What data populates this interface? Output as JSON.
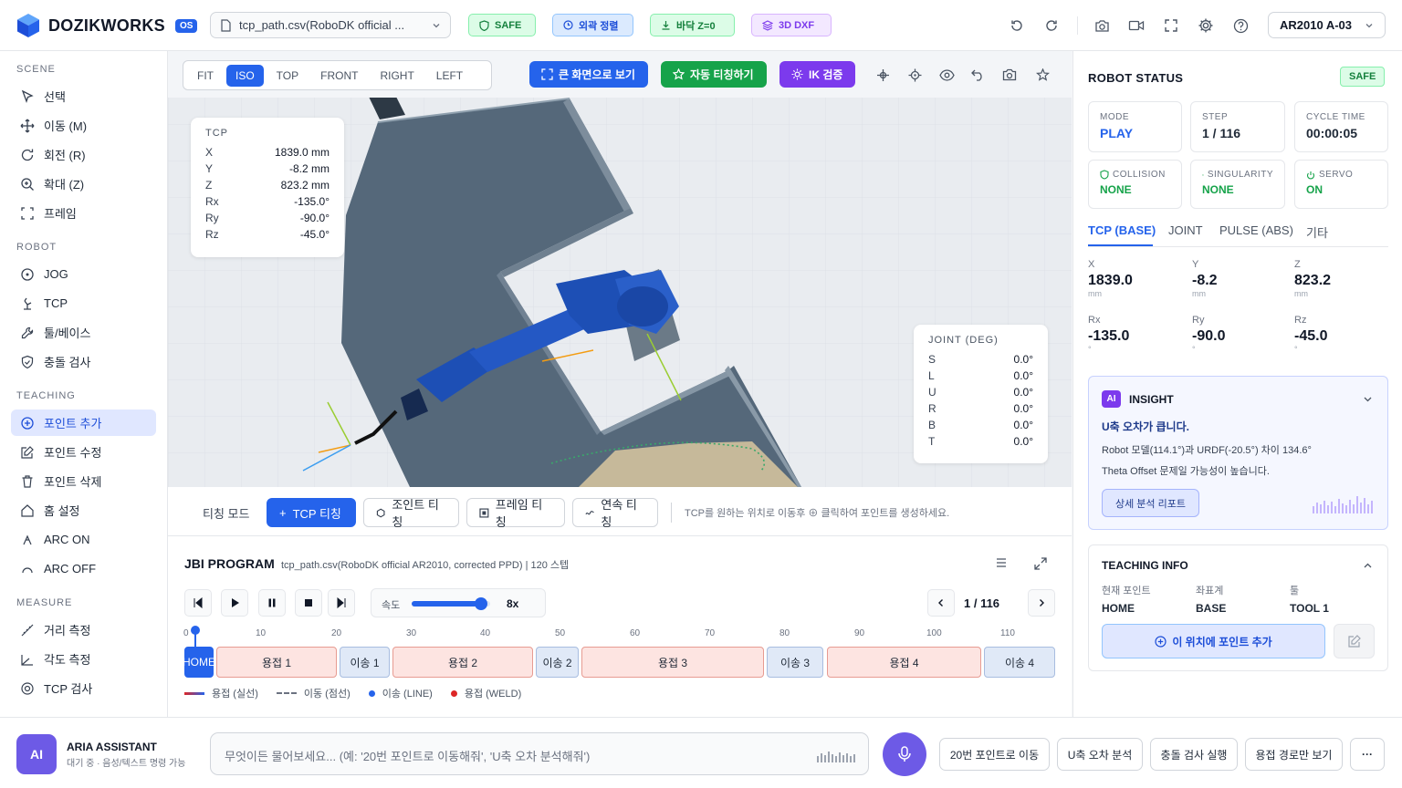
{
  "header": {
    "brand": "DOZIKWORKS",
    "os_badge": "OS",
    "file_name": "tcp_path.csv(RoboDK official ...",
    "badges": {
      "safe": "SAFE",
      "align": "외곽 정렬",
      "floor": "바닥 Z=0",
      "dxf": "3D DXF"
    },
    "model": "AR2010 A-03"
  },
  "sidebar": {
    "scene_title": "SCENE",
    "scene": [
      "선택",
      "이동 (M)",
      "회전 (R)",
      "확대 (Z)",
      "프레임"
    ],
    "robot_title": "ROBOT",
    "robot": [
      "JOG",
      "TCP",
      "툴/베이스",
      "충돌 검사"
    ],
    "teaching_title": "TEACHING",
    "teaching": [
      "포인트 추가",
      "포인트 수정",
      "포인트 삭제",
      "홈 설정",
      "ARC ON",
      "ARC OFF"
    ],
    "measure_title": "MEASURE",
    "measure": [
      "거리 측정",
      "각도 측정",
      "TCP 검사"
    ]
  },
  "viewport": {
    "views": [
      "FIT",
      "ISO",
      "TOP",
      "FRONT",
      "RIGHT",
      "LEFT"
    ],
    "active_view": "ISO",
    "btn_fullscreen": "큰 화면으로 보기",
    "btn_auto_teach": "자동 티칭하기",
    "btn_ik": "IK 검증",
    "tcp": {
      "title": "TCP",
      "rows": [
        {
          "k": "X",
          "v": "1839.0 mm"
        },
        {
          "k": "Y",
          "v": "-8.2 mm"
        },
        {
          "k": "Z",
          "v": "823.2 mm"
        },
        {
          "k": "Rx",
          "v": "-135.0°"
        },
        {
          "k": "Ry",
          "v": "-90.0°"
        },
        {
          "k": "Rz",
          "v": "-45.0°"
        }
      ]
    },
    "joint": {
      "title": "JOINT (DEG)",
      "rows": [
        {
          "k": "S",
          "v": "0.0°"
        },
        {
          "k": "L",
          "v": "0.0°"
        },
        {
          "k": "U",
          "v": "0.0°"
        },
        {
          "k": "R",
          "v": "0.0°"
        },
        {
          "k": "B",
          "v": "0.0°"
        },
        {
          "k": "T",
          "v": "0.0°"
        }
      ]
    }
  },
  "teach_bar": {
    "mode_label": "티칭 모드",
    "tcp_teach": "TCP 티칭",
    "joint_teach": "조인트 티칭",
    "frame_teach": "프레임 티칭",
    "cont_teach": "연속 티칭",
    "hint": "TCP를 원하는 위치로 이동후 ⊕ 클릭하여 포인트를 생성하세요."
  },
  "jbi": {
    "title": "JBI PROGRAM",
    "subtitle": "tcp_path.csv(RoboDK official AR2010, corrected PPD) | 120 스텝",
    "speed_label": "속도",
    "speed_value": "8x",
    "speed_fraction": 0.88,
    "step": "1 / 116",
    "ticks": [
      "0",
      "10",
      "20",
      "30",
      "40",
      "50",
      "60",
      "70",
      "80",
      "90",
      "100",
      "110"
    ],
    "segments": [
      {
        "label": "HOME",
        "type": "home"
      },
      {
        "label": "용접 1",
        "type": "weld"
      },
      {
        "label": "이송 1",
        "type": "move"
      },
      {
        "label": "용접 2",
        "type": "weld"
      },
      {
        "label": "이송 2",
        "type": "move"
      },
      {
        "label": "용접 3",
        "type": "weld"
      },
      {
        "label": "이송 3",
        "type": "move"
      },
      {
        "label": "용접 4",
        "type": "weld"
      },
      {
        "label": "이송 4",
        "type": "move"
      }
    ],
    "legend": [
      "용접 (실선)",
      "이동 (점선)",
      "이송 (LINE)",
      "용접 (WELD)"
    ]
  },
  "robot_status": {
    "title": "ROBOT STATUS",
    "safe": "SAFE",
    "mode_label": "MODE",
    "mode": "PLAY",
    "step_label": "STEP",
    "step": "1 / 116",
    "cycle_label": "CYCLE TIME",
    "cycle": "00:00:05",
    "collision_label": "COLLISION",
    "collision": "NONE",
    "singularity_label": "SINGULARITY",
    "singularity": "NONE",
    "servo_label": "SERVO",
    "servo": "ON",
    "tabs": [
      "TCP (BASE)",
      "JOINT",
      "PULSE (ABS)",
      "기타"
    ],
    "coords": [
      {
        "k": "X",
        "v": "1839.0",
        "u": "mm"
      },
      {
        "k": "Y",
        "v": "-8.2",
        "u": "mm"
      },
      {
        "k": "Z",
        "v": "823.2",
        "u": "mm"
      },
      {
        "k": "Rx",
        "v": "-135.0",
        "u": "°"
      },
      {
        "k": "Ry",
        "v": "-90.0",
        "u": "°"
      },
      {
        "k": "Rz",
        "v": "-45.0",
        "u": "°"
      }
    ]
  },
  "insight": {
    "badge": "AI",
    "title": "INSIGHT",
    "headline": "U축 오차가 큽니다.",
    "line1": "Robot 모델(114.1°)과 URDF(-20.5°) 차이 134.6°",
    "line2": "Theta Offset 문제일 가능성이 높습니다.",
    "report_btn": "상세 분석 리포트"
  },
  "teaching_info": {
    "title": "TEACHING INFO",
    "current_point_label": "현재 포인트",
    "current_point": "HOME",
    "coord_label": "좌표계",
    "coord": "BASE",
    "tool_label": "툴",
    "tool": "TOOL 1",
    "add_btn": "이 위치에 포인트 추가"
  },
  "assistant": {
    "badge": "AI",
    "name": "ARIA ASSISTANT",
    "status": "대기 중 · 음성/텍스트 명령 가능",
    "placeholder": "무엇이든 물어보세요... (예: '20번 포인트로 이동해줘', 'U축 오차 분석해줘')",
    "quick": [
      "20번 포인트로 이동",
      "U축 오차 분석",
      "충돌 검사 실행",
      "용접 경로만 보기"
    ],
    "more": "···"
  },
  "colors": {
    "primary": "#2563eb",
    "green": "#16a34a",
    "purple": "#7c3aed",
    "robot_blue": "#1d4fb5"
  }
}
